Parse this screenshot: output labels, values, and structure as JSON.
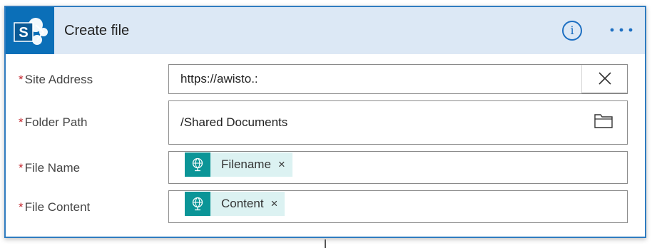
{
  "header": {
    "title": "Create file",
    "info_label": "i",
    "brand_color": "#0b6fb8",
    "header_bg": "#dce8f5"
  },
  "fields": {
    "site_address": {
      "label": "Site Address",
      "required_mark": "*",
      "value": "https://awisto.:",
      "clear_label": "×"
    },
    "folder_path": {
      "label": "Folder Path",
      "required_mark": "*",
      "value": "/Shared Documents",
      "icon": "folder-icon"
    },
    "file_name": {
      "label": "File Name",
      "required_mark": "*",
      "token": {
        "label": "Filename",
        "remove_label": "×",
        "icon": "globe-icon",
        "color": "#0b9597"
      }
    },
    "file_content": {
      "label": "File Content",
      "required_mark": "*",
      "token": {
        "label": "Content",
        "remove_label": "×",
        "icon": "globe-icon",
        "color": "#0b9597"
      }
    }
  }
}
